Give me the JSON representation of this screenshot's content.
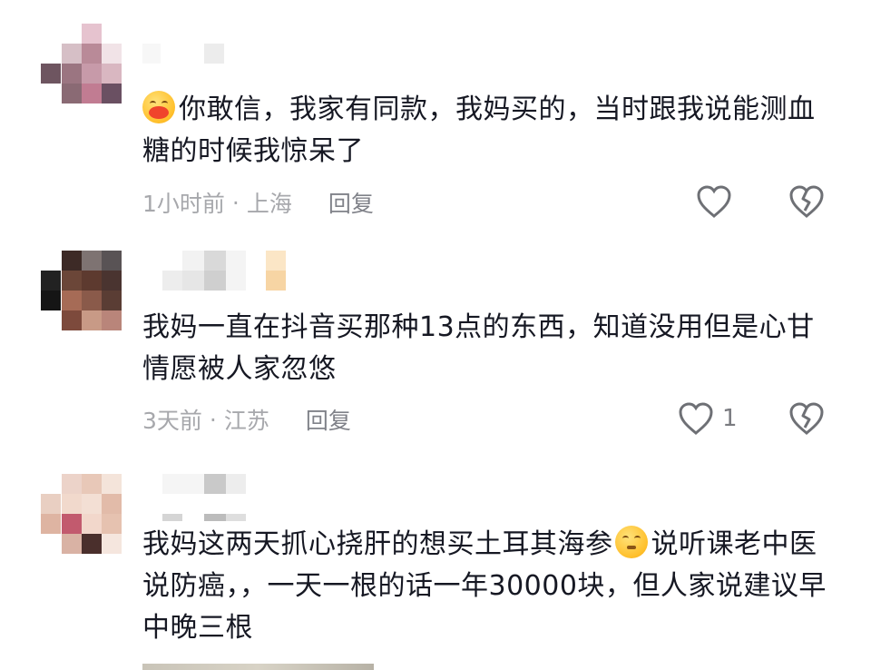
{
  "comments": [
    {
      "text": "你敢信，我家有同款，我妈买的，当时跟我说能测血糖的时候我惊呆了",
      "time": "1小时前",
      "separator": "·",
      "location": "上海",
      "reply_label": "回复",
      "like_count": "",
      "like_icon": "heart-outline-icon",
      "dislike_icon": "broken-heart-icon"
    },
    {
      "text": "我妈一直在抖音买那种13点的东西，知道没用但是心甘情愿被人家忽悠",
      "time": "3天前",
      "separator": "·",
      "location": "江苏",
      "reply_label": "回复",
      "like_count": "1",
      "like_icon": "heart-outline-icon",
      "dislike_icon": "broken-heart-icon"
    },
    {
      "text_before_emoji": "我妈这两天抓心挠肝的想买土耳其海参",
      "text_after_emoji": "说听课老中医说防癌，，一天一根的话一年30000块，但人家说建议早中晚三根"
    }
  ],
  "colors": {
    "text": "#161823",
    "meta": "#a7a8ac",
    "reply": "#808289",
    "icon": "#7a7b80"
  }
}
